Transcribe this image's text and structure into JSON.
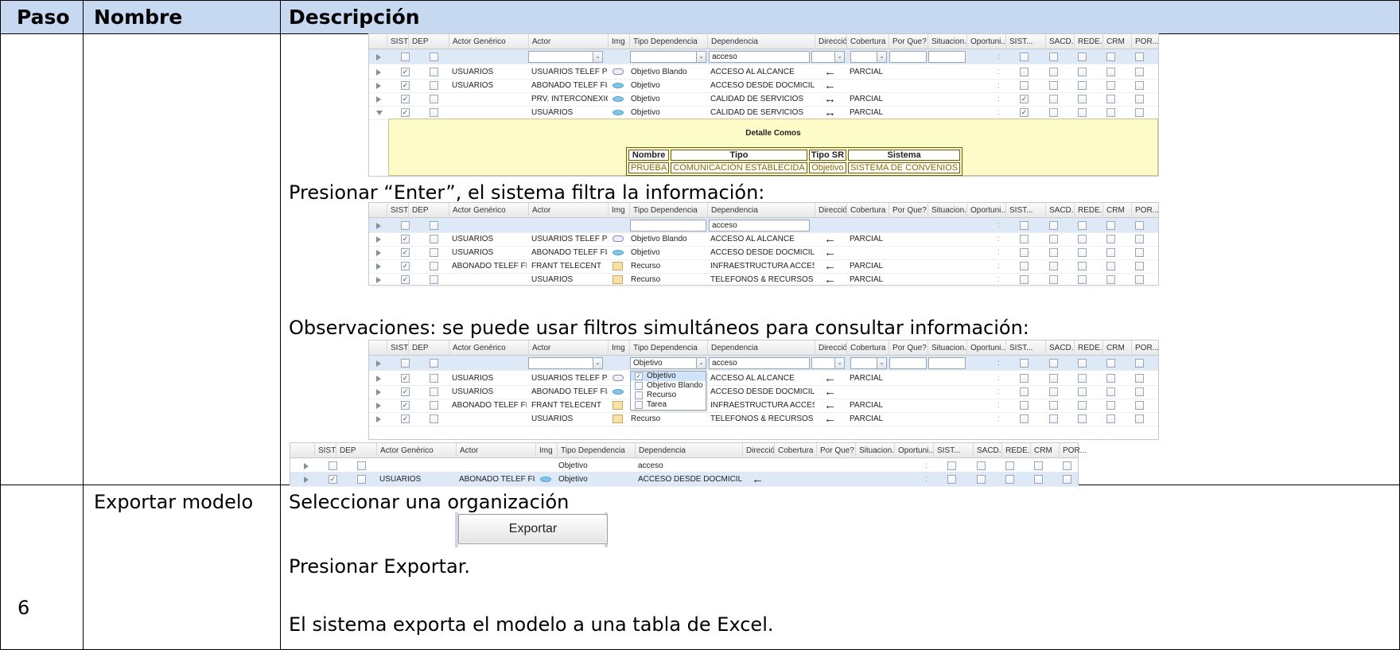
{
  "header": {
    "paso": "Paso",
    "nombre": "Nombre",
    "descripcion": "Descripción"
  },
  "captions": {
    "enter": "Presionar “Enter”, el sistema filtra la información:",
    "observaciones": "Observaciones: se puede usar filtros simultáneos para consultar información:"
  },
  "grid_columns": [
    "SIST...",
    "DEP ...",
    "Actor Genérico",
    "Actor",
    "Img",
    "Tipo Dependencia",
    "Dependencia",
    "Dirección",
    "Cobertura",
    "Por Que?",
    "Situacion...",
    "Oportuni...",
    "SIST...",
    "SACD...",
    "REDE...",
    "CRM",
    "POR..."
  ],
  "grid_columns_sorted_first": "SIST ▾",
  "grid1": {
    "filter_dependencia": "acceso",
    "rows": [
      {
        "sist": true,
        "dep": false,
        "actor_generico": "USUARIOS",
        "actor": "USUARIOS TELEF PU...",
        "img": "soft-goal-icon",
        "tipo": "Objetivo Blando",
        "dependencia": "ACCESO AL ALCANCE",
        "direccion": "←",
        "cobertura": "PARCIAL",
        "sist2": false
      },
      {
        "sist": true,
        "dep": false,
        "actor_generico": "USUARIOS",
        "actor": "ABONADO TELEF FIJ...",
        "img": "goal-icon",
        "tipo": "Objetivo",
        "dependencia": "ACCESO DESDE DOCMICILIO",
        "direccion": "←",
        "cobertura": "",
        "sist2": false
      },
      {
        "sist": true,
        "dep": false,
        "actor_generico": "",
        "actor": "PRV. INTERCONEXIÓN",
        "img": "goal-icon",
        "tipo": "Objetivo",
        "dependencia": "CALIDAD DE SERVICIOS",
        "direccion": "↔",
        "cobertura": "PARCIAL",
        "sist2": true
      },
      {
        "sist": true,
        "dep": false,
        "actor_generico": "",
        "actor": "USUARIOS",
        "img": "goal-icon",
        "tipo": "Objetivo",
        "dependencia": "CALIDAD DE SERVICIOS",
        "direccion": "↔",
        "cobertura": "PARCIAL",
        "sist2": true
      }
    ],
    "detail": {
      "title": "Detalle Comos",
      "headers": [
        "Nombre",
        "Tipo",
        "Tipo SR",
        "Sistema"
      ],
      "values": [
        "PRUEBA",
        "COMUNICACIÓN ESTABLECIDA",
        "Objetivo",
        "SISTEMA DE CONVENIOS"
      ]
    }
  },
  "grid2": {
    "filter_dependencia": "acceso",
    "rows": [
      {
        "sist": true,
        "actor_generico": "USUARIOS",
        "actor": "USUARIOS TELEF PU...",
        "img": "soft-goal-icon",
        "tipo": "Objetivo Blando",
        "dependencia": "ACCESO AL ALCANCE",
        "direccion": "←",
        "cobertura": "PARCIAL"
      },
      {
        "sist": true,
        "actor_generico": "USUARIOS",
        "actor": "ABONADO TELEF FIJ...",
        "img": "goal-icon",
        "tipo": "Objetivo",
        "dependencia": "ACCESO DESDE DOCMICILIO",
        "direccion": "←",
        "cobertura": ""
      },
      {
        "sist": true,
        "actor_generico": "ABONADO TELEF FIJ...",
        "actor": "FRANT TELECENT",
        "img": "resource-icon",
        "tipo": "Recurso",
        "dependencia": "INFRAESTRUCTURA ACCES...",
        "direccion": "←",
        "cobertura": "PARCIAL"
      },
      {
        "sist": true,
        "actor_generico": "",
        "actor": "USUARIOS",
        "img": "resource-icon",
        "tipo": "Recurso",
        "dependencia": "TELEFONOS & RECURSOS A...",
        "direccion": "←",
        "cobertura": "PARCIAL"
      }
    ]
  },
  "grid3": {
    "filter_tipo": "Objetivo",
    "filter_dependencia": "acceso",
    "dropdown_options": [
      {
        "label": "Objetivo",
        "checked": true
      },
      {
        "label": "Objetivo Blando",
        "checked": false
      },
      {
        "label": "Recurso",
        "checked": false
      },
      {
        "label": "Tarea",
        "checked": false
      }
    ],
    "rows": [
      {
        "actor_generico": "USUARIOS",
        "actor": "USUARIOS TELEF PU...",
        "img": "soft-goal-icon",
        "tipo": "",
        "dependencia": "ACCESO AL ALCANCE",
        "direccion": "←",
        "cobertura": "PARCIAL"
      },
      {
        "actor_generico": "USUARIOS",
        "actor": "ABONADO TELEF FIJ...",
        "img": "goal-icon",
        "tipo": "",
        "dependencia": "ACCESO DESDE DOCMICILIO",
        "direccion": "←",
        "cobertura": ""
      },
      {
        "actor_generico": "ABONADO TELEF FIJ...",
        "actor": "FRANT TELECENT",
        "img": "resource-icon",
        "tipo": "",
        "dependencia": "INFRAESTRUCTURA ACCES...",
        "direccion": "←",
        "cobertura": "PARCIAL"
      },
      {
        "actor_generico": "",
        "actor": "USUARIOS",
        "img": "resource-icon",
        "tipo": "Recurso",
        "dependencia": "TELEFONOS & RECURSOS A...",
        "direccion": "←",
        "cobertura": "PARCIAL"
      }
    ]
  },
  "grid4": {
    "filter_tipo": "Objetivo",
    "filter_dependencia": "acceso",
    "row": {
      "actor_generico": "USUARIOS",
      "actor": "ABONADO TELEF FIJ...",
      "img": "goal-icon",
      "tipo": "Objetivo",
      "dependencia": "ACCESO DESDE DOCMICILIO",
      "direccion": "←"
    }
  },
  "step6": {
    "paso": "6",
    "nombre": "Exportar modelo",
    "line1": "Seleccionar una organización",
    "line2": "Presionar Exportar.",
    "button": "Exportar",
    "line3": "El sistema exporta el modelo a una tabla de Excel."
  }
}
